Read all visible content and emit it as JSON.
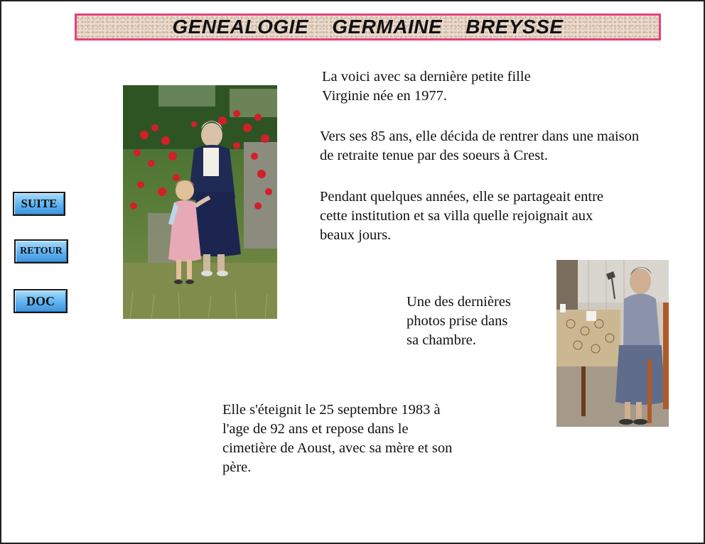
{
  "header": {
    "title": "GENEALOGIE    GERMAINE    BREYSSE"
  },
  "nav": {
    "suite_label": "SUITE",
    "retour_label": "RETOUR",
    "doc_label": "DOC"
  },
  "content": {
    "paragraph_1": [
      "La voici avec sa dernière petite fille",
      "Virginie née en 1977."
    ],
    "paragraph_2": [
      "Vers ses 85 ans, elle décida de rentrer dans une maison",
      "de retraite tenue par des soeurs à Crest."
    ],
    "paragraph_3": [
      "Pendant quelques années, elle se partageait entre",
      "cette institution et sa villa quelle rejoignait aux",
      "beaux jours."
    ],
    "caption_room": [
      "Une des dernières",
      "photos prise dans",
      "sa chambre."
    ],
    "paragraph_4": [
      "Elle s'éteignit le 25 septembre 1983 à",
      "l'age de 92 ans et repose dans le",
      "cimetière de Aoust, avec sa mère et son",
      "père."
    ]
  },
  "colors": {
    "banner_border": "#e8407a",
    "button_blue": "#5fb2f1"
  }
}
